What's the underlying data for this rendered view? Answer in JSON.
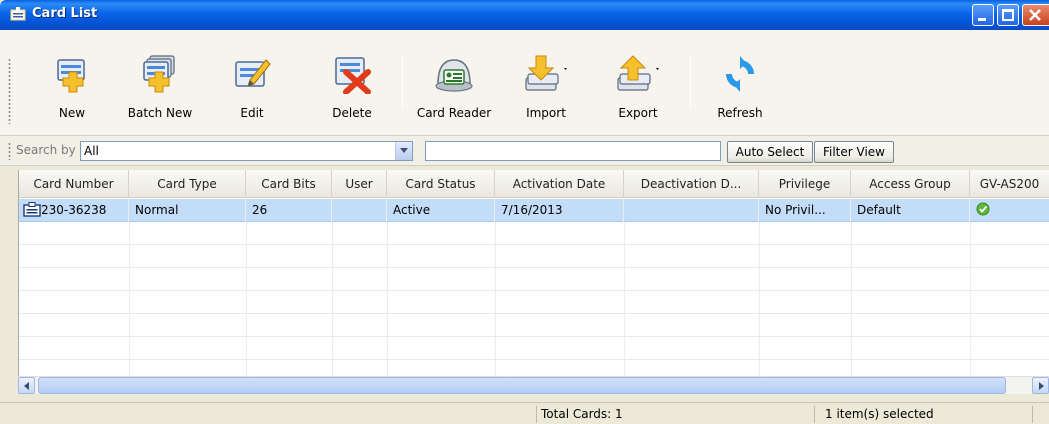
{
  "window": {
    "title": "Card List"
  },
  "toolbar": {
    "buttons": [
      {
        "label": "New",
        "icon": "new-card-icon"
      },
      {
        "label": "Batch New",
        "icon": "batch-new-icon"
      },
      {
        "label": "Edit",
        "icon": "edit-icon"
      },
      {
        "label": "Delete",
        "icon": "delete-icon"
      },
      {
        "label": "Card Reader",
        "icon": "card-reader-icon"
      },
      {
        "label": "Import",
        "icon": "import-icon"
      },
      {
        "label": "Export",
        "icon": "export-icon"
      },
      {
        "label": "Refresh",
        "icon": "refresh-icon"
      }
    ]
  },
  "search": {
    "label": "Search by",
    "selected": "All",
    "value": "",
    "auto_select": "Auto Select",
    "filter_view": "Filter View"
  },
  "table": {
    "columns": [
      "Card Number",
      "Card Type",
      "Card Bits",
      "User",
      "Card Status",
      "Activation Date",
      "Deactivation D...",
      "Privilege",
      "Access Group",
      "GV-AS200"
    ],
    "rows": [
      {
        "card_number": "230-36238",
        "card_type": "Normal",
        "card_bits": "26",
        "user": "",
        "card_status": "Active",
        "activation_date": "7/16/2013",
        "deactivation_date": "",
        "privilege": "No Privil...",
        "access_group": "Default",
        "gv_as200": "check-icon"
      }
    ]
  },
  "status": {
    "total_cards": "Total Cards: 1",
    "selection": "1 item(s) selected"
  },
  "colors": {
    "title_bar": "#0a5fe0",
    "selected_row": "#c3ddf9",
    "check": "#5cb83a"
  }
}
